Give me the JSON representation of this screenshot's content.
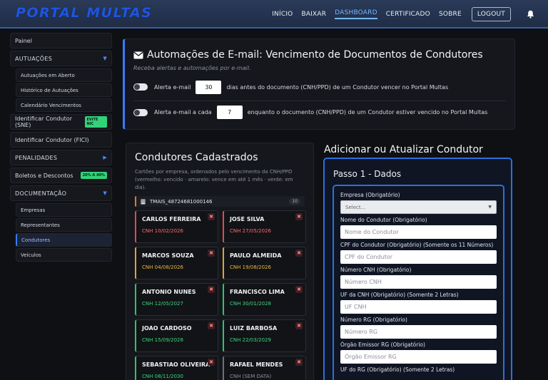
{
  "brand": "PORTAL MULTAS",
  "nav": {
    "items": [
      "INÍCIO",
      "BAIXAR",
      "DASHBOARD",
      "CERTIFICADO",
      "SOBRE"
    ],
    "logout": "LOGOUT"
  },
  "sidebar": {
    "painel": "Painel",
    "autuacoes": "AUTUAÇÕES",
    "autuacoes_items": [
      "Autuações em Aberto",
      "Histórico de Autuações",
      "Calendário Vencimentos"
    ],
    "sne": "Identificar Condutor (SNE)",
    "sne_badge": "EVITE NIC",
    "fici": "Identificar Condutor (FICI)",
    "penalidades": "PENALIDADES",
    "boletos": "Boletos e Descontos",
    "boletos_badge": "20% A 40%",
    "documentacao": "DOCUMENTAÇÃO",
    "doc_items": [
      "Empresas",
      "Representantes",
      "Condutores",
      "Veículos"
    ]
  },
  "automation": {
    "title": "Automações de E-mail: Vencimento de Documentos de Condutores",
    "subtitle": "Receba alertas e automações por e-mail.",
    "row1_prefix": "Alerta e-mail",
    "row1_value": "30",
    "row1_suffix": "dias antes do documento (CNH/PPD) de um Condutor vencer no Portal Multas",
    "row2_prefix": "Alerta e-mail a cada",
    "row2_value": "7",
    "row2_suffix": "enquanto o documento (CNH/PPD) de um Condutor estiver vencido no Portal Multas"
  },
  "drivers": {
    "title": "Condutores Cadastrados",
    "subtitle1": "Cartões por empresa, ordenados pelo vencimento da CNH/PPD",
    "subtitle2": "(vermelho: vencido · amarelo: vence em até 1 mês · verde: em dia).",
    "company": "TMAIS_48724681000146",
    "company_count": "10",
    "cards": [
      {
        "name": "CARLOS FERREIRA",
        "cnh": "CNH 10/02/2026",
        "status": "red"
      },
      {
        "name": "JOSE SILVA",
        "cnh": "CNH 27/05/2026",
        "status": "red"
      },
      {
        "name": "MARCOS SOUZA",
        "cnh": "CNH 04/08/2026",
        "status": "yellow"
      },
      {
        "name": "PAULO ALMEIDA",
        "cnh": "CNH 19/08/2026",
        "status": "yellow"
      },
      {
        "name": "ANTONIO NUNES",
        "cnh": "CNH 12/05/2027",
        "status": "green"
      },
      {
        "name": "FRANCISCO LIMA",
        "cnh": "CNH 30/01/2028",
        "status": "green"
      },
      {
        "name": "JOAO CARDOSO",
        "cnh": "CNH 15/09/2028",
        "status": "green"
      },
      {
        "name": "LUIZ BARBOSA",
        "cnh": "CNH 22/03/2029",
        "status": "green"
      },
      {
        "name": "SEBASTIAO OLIVEIRA",
        "cnh": "CNH 08/11/2030",
        "status": "green"
      },
      {
        "name": "RAFAEL MENDES",
        "cnh": "CNH (SEM DATA)",
        "status": "grey"
      }
    ],
    "delete_glyph": "✖"
  },
  "form": {
    "title": "Adicionar ou Atualizar Condutor",
    "step": "Passo 1 - Dados",
    "empresa_label": "Empresa (Obrigatório)",
    "empresa_placeholder": "Select...",
    "fields": [
      {
        "label": "Nome do Condutor (Obrigatório)",
        "placeholder": "Nome do Condutor"
      },
      {
        "label": "CPF do Condutor (Obrigatório) (Somente os 11 Números)",
        "placeholder": "CPF do Condutor"
      },
      {
        "label": "Número CNH (Obrigatório)",
        "placeholder": "Número CNH"
      },
      {
        "label": "UF da CNH (Obrigatório) (Somente 2 Letras)",
        "placeholder": "UF CNH"
      },
      {
        "label": "Número RG (Obrigatório)",
        "placeholder": "Número RG"
      },
      {
        "label": "Órgão Emissor RG (Obrigatório)",
        "placeholder": "Órgão Emissor RG"
      }
    ],
    "last_label": "UF do RG (Obrigatório) (Somente 2 Letras)"
  },
  "colors": {
    "accent": "#3b7bff",
    "expired": "#e24a4a",
    "soon": "#e0a52e",
    "ok": "#2ec46a"
  },
  "icons": {
    "automation": "envelope-icon",
    "notification": "bell-icon",
    "company": "building-icon"
  }
}
